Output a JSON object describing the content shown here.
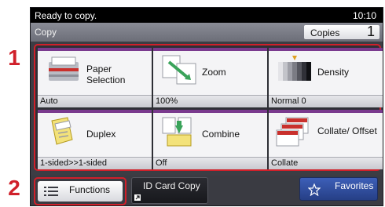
{
  "callouts": {
    "first": "1",
    "second": "2"
  },
  "status_bar": {
    "message": "Ready to copy.",
    "time": "10:10"
  },
  "title_bar": {
    "title": "Copy",
    "copies_label": "Copies",
    "copies_count": "1"
  },
  "tiles": [
    {
      "label": "Paper Selection",
      "value": "Auto",
      "icon": "paper-tray-icon"
    },
    {
      "label": "Zoom",
      "value": "100%",
      "icon": "zoom-icon"
    },
    {
      "label": "Density",
      "value": "Normal 0",
      "icon": "density-icon"
    },
    {
      "label": "Duplex",
      "value": "1-sided>>1-sided",
      "icon": "duplex-icon"
    },
    {
      "label": "Combine",
      "value": "Off",
      "icon": "combine-icon"
    },
    {
      "label": "Collate/ Offset",
      "value": "Collate",
      "icon": "collate-icon"
    }
  ],
  "bottom_bar": {
    "functions_label": "Functions",
    "id_card_label": "ID Card Copy",
    "favorites_label": "Favorites"
  },
  "colors": {
    "accent": "#7a3a8e",
    "callout": "#d0202a",
    "favorites": "#2f4fa3"
  }
}
